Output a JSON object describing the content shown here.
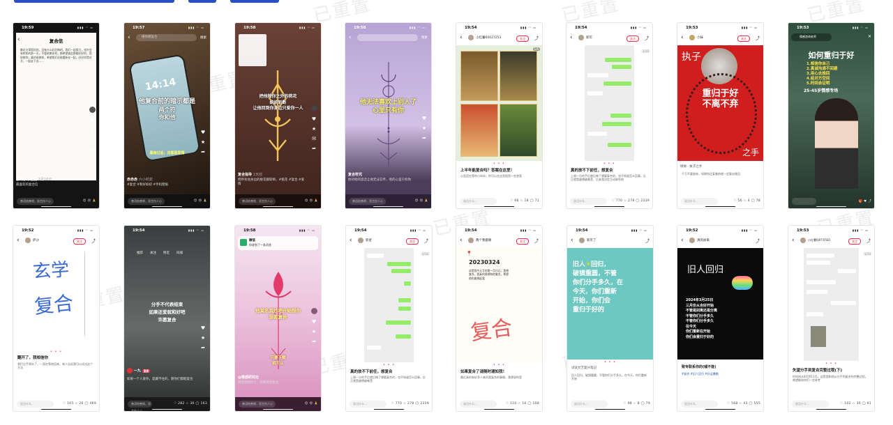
{
  "p1": {
    "time": "19:59",
    "title": "复合信",
    "body": "最近分享挺好的，没有什么好后悔的，我们一起努力，也许会有转机的那一天，不管结果如何，都希望彼此都能好好的，我很想你，真的很想你，希望我们还能重新在一起，好好珍惜对方，一起走下去……",
    "handle": "赤峰参卡花药",
    "date": "3月16日",
    "caption": "最喜欢的复合信",
    "comment": "善语结善缘，恶言伤人心"
  },
  "p2": {
    "time": "19:57",
    "search": "撞你撞复合",
    "search_btn": "搜索",
    "line1": "他复合前的暗示都是",
    "line2": "两个符",
    "line3": "你和他",
    "sub": "暴雨过后，这都是爱情",
    "handle": "赤赤赤",
    "date": "六小时前",
    "caption": "#复合 #和好如初 #手机壁纸",
    "comment": "善语结善缘，恶言伤人心"
  },
  "p3": {
    "time": "19:58",
    "line1": "把他除你之外的桃花",
    "line2": "统统斩断",
    "line3": "让他回到你身边只爱你一人",
    "handle": "复合指导",
    "date": "1天前",
    "caption": "把所有他身边的桃花都斩断，#桃花 #复合 #爱情",
    "comment": "善语结善缘，恶言伤人心"
  },
  "p4": {
    "time": "19:58",
    "line1": "他无法喜欢上别人了",
    "line2": "心里只有你",
    "handle": "复合符咒",
    "date": "",
    "caption": "你对他的思念让他无法忘怀，他的心里只有你",
    "comment": "善语结善缘，恶言伤人心"
  },
  "p5": {
    "time": "19:54",
    "author": "小红薯60027253",
    "follow": "关注",
    "badge": "1/6",
    "title": "上半年能复合吗？答案在这里！",
    "sub": "心里还在等的小伙伴，你可以在这里找到一些答案",
    "comment": "说点什么...",
    "likes": "96",
    "stars": "18",
    "cmts": "71"
  },
  "p6": {
    "time": "19:54",
    "author": "新年",
    "follow": "关注",
    "badge": "1/10",
    "title": "真的放不下前任，想复合",
    "body": "上周一分的手后就后悔了想要复合的，也不知道怎么回事，反正就是越想越难受，后来我决定主动联系他",
    "comment": "说点什么...",
    "likes": "770",
    "stars": "278",
    "cmts": "2339"
  },
  "p7": {
    "time": "19:53",
    "author": "小妹",
    "follow": "关注",
    "top": "执子",
    "center1": "重归于好",
    "center2": "不离不弃",
    "bottom": "之手",
    "tag": "情缘 · 执子之手",
    "sub": "千万不要放弃，如果你还爱着他就一定要去挽回",
    "comment": "说点什么...",
    "likes": "56",
    "stars": "4",
    "cmts": "78"
  },
  "p8": {
    "time": "19:53",
    "author": "情感咨询老师",
    "title": "如何重归于好",
    "points": [
      "1.相信你自己",
      "2.真诚沟通不回避",
      "3.用心去挽回",
      "4.给对方空间",
      "5.时间会证明"
    ],
    "bottom": "25-45岁情感专场"
  },
  "p9": {
    "time": "19:52",
    "author": "萨沙",
    "follow": "关注",
    "hw1": "玄学",
    "hw2": "复合",
    "title": "翻开了，我相信你",
    "body": "我们分手两年了，一直在等他回来，有人告诉我可以试试这个方法",
    "comment": "说点什么...",
    "likes": "165",
    "stars": "26",
    "cmts": "469"
  },
  "p10": {
    "time": "19:54",
    "tabs": [
      "推荐",
      "关注",
      "附近",
      "同城"
    ],
    "line1": "分手不代表结束",
    "line2": "如果还爱就和好吧",
    "line3": "许愿复合",
    "handle": "一九",
    "live": "直播",
    "caption": "如果一个人爱你，是藏不住的，愿你们都能复合",
    "comment": "善语结善缘，恶言伤人心",
    "likes": "282",
    "stars": "36",
    "cmts": "163"
  },
  "p11": {
    "time": "19:58",
    "notif1": "微信",
    "notif2": "你收到了一条消息",
    "line1": "他莫名其妙地开始想你",
    "line2": "想要复合",
    "line3": "只要下载",
    "line4": "就可以",
    "handle": "@情感研究社",
    "caption": "他突然想你了，想要和你复合",
    "comment": "善语结善缘，恶言伤人心"
  },
  "p12": {
    "time": "19:54",
    "author": "新星",
    "follow": "关注",
    "badge": "1/10",
    "title": "真的放不下前任，想复合",
    "body": "上周一分的手后就后悔了想要复合的，也不知道怎么回事，反正就是越想越难受",
    "comment": "说点什么...",
    "likes": "770",
    "stars": "278",
    "cmts": "2339"
  },
  "p13": {
    "time": "19:54",
    "author": "两个我都要",
    "follow": "关注",
    "date": "20230324",
    "note": "这是我今天写的第一页日记，我想复合，我真的很想和他复合，希望他也能想起我",
    "hw": "复合",
    "title": "如果复合了请随时通知我！",
    "body": "最近真的有好多人来问我复合的事情，我想说的是",
    "comment": "说点什么...",
    "likes": "110",
    "stars": "16",
    "cmts": "108"
  },
  "p14": {
    "time": "19:54",
    "author": "新年了",
    "lines": [
      "旧人",
      "回归，",
      "破镜重圆，不管",
      "你们分手多久，在",
      "今天，你们重新",
      "开始，你们会",
      "重归于好的"
    ],
    "tag": "试试文艺复兴笔记",
    "sub": "旧人回归，破镜重圆，不管你们分手多久，在今天，你们重新开始",
    "comment": "说点什么...",
    "likes": "98",
    "stars": "8",
    "cmts": "79"
  },
  "p15": {
    "time": "19:52",
    "author": "清风徐来",
    "title": "旧人回归",
    "body": [
      "2024年3月25日",
      "三月份从合好开始",
      "不管是别离还是分离",
      "不管你们分手多久",
      "不管你们分手多久",
      "在今天",
      "你们重新在开始",
      "你们会重归于好的"
    ],
    "caption": "致专联系你的(嘘不能)",
    "tags": "#复合 #旧人回归 #好运爆棚",
    "comment": "说点什么...",
    "likes": "568",
    "stars": "43",
    "cmts": "555"
  },
  "p16": {
    "time": "19:53",
    "author": "小红薯60FF05EO",
    "follow": "关注",
    "badge": "1/14",
    "title": "失望分手到复合完整过程(下)",
    "body": "时间线从8月到11月，这是我和他从分手到复合的完整过程，希望能给你们一些参考",
    "comment": "说点什么...",
    "likes": "102",
    "stars": "30",
    "cmts": "91"
  },
  "shared": {
    "watermark": "已重置"
  }
}
